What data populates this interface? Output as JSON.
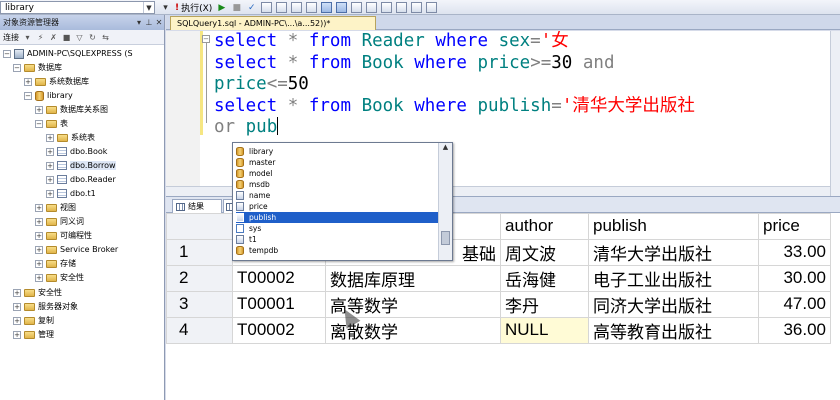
{
  "toolbar": {
    "database": "library",
    "execute_label": "执行(X)"
  },
  "explorer": {
    "title": "对象资源管理器",
    "connect_label": "连接",
    "nodes": [
      {
        "label": "ADMIN-PC\\SQLEXPRESS (S"
      },
      {
        "label": "数据库"
      },
      {
        "label": "系统数据库"
      },
      {
        "label": "library"
      },
      {
        "label": "数据库关系图"
      },
      {
        "label": "表"
      },
      {
        "label": "系统表"
      },
      {
        "label": "dbo.Book"
      },
      {
        "label": "dbo.Borrow"
      },
      {
        "label": "dbo.Reader"
      },
      {
        "label": "dbo.t1"
      },
      {
        "label": "视图"
      },
      {
        "label": "同义词"
      },
      {
        "label": "可编程性"
      },
      {
        "label": "Service Broker"
      },
      {
        "label": "存储"
      },
      {
        "label": "安全性"
      },
      {
        "label": "安全性"
      },
      {
        "label": "服务器对象"
      },
      {
        "label": "复制"
      },
      {
        "label": "管理"
      }
    ]
  },
  "editor": {
    "tab_title": "SQLQuery1.sql - ADMIN-PC\\...\\a...52))*",
    "lines": {
      "l1": {
        "kw1": "select",
        "star": "*",
        "kw2": "from",
        "table": "Reader",
        "kw3": "where",
        "col": "sex",
        "op": "=",
        "str": "'女"
      },
      "l2": {
        "kw1": "select",
        "star": "*",
        "kw2": "from",
        "table": "Book",
        "kw3": "where",
        "col": "price",
        "op": ">=",
        "num": "30",
        "kw4": "and"
      },
      "l3": {
        "col": "price",
        "op": "<=",
        "num": "50"
      },
      "l4": {
        "kw1": "select",
        "star": "*",
        "kw2": "from",
        "table": "Book",
        "kw3": "where",
        "col": "publish",
        "op": "=",
        "str": "'清华大学出版社"
      },
      "l5": {
        "kw": "or",
        "partial": "pub"
      }
    }
  },
  "autocomplete": {
    "items": [
      "library",
      "master",
      "model",
      "msdb",
      "name",
      "price",
      "publish",
      "sys",
      "t1",
      "tempdb"
    ],
    "selected": "publish"
  },
  "results": {
    "tabs": [
      {
        "label": "结果"
      }
    ],
    "headers": [
      "author",
      "publish",
      "price"
    ],
    "rows": [
      {
        "n": "1",
        "id": "",
        "name": "基础",
        "author": "周文波",
        "publish": "清华大学出版社",
        "price": "33.00"
      },
      {
        "n": "2",
        "id": "T00002",
        "name": "数据库原理",
        "author": "岳海健",
        "publish": "电子工业出版社",
        "price": "30.00"
      },
      {
        "n": "3",
        "id": "T00001",
        "name": "高等数学",
        "author": "李丹",
        "publish": "同济大学出版社",
        "price": "47.00"
      },
      {
        "n": "4",
        "id": "T00002",
        "name": "离散数学",
        "author": "NULL",
        "publish": "高等教育出版社",
        "price": "36.00"
      }
    ]
  },
  "colors": {
    "keyword": "#0000ff",
    "table_name": "#008080",
    "operator": "#808080",
    "string": "#ff0000",
    "selection": "#1f5fc9"
  }
}
